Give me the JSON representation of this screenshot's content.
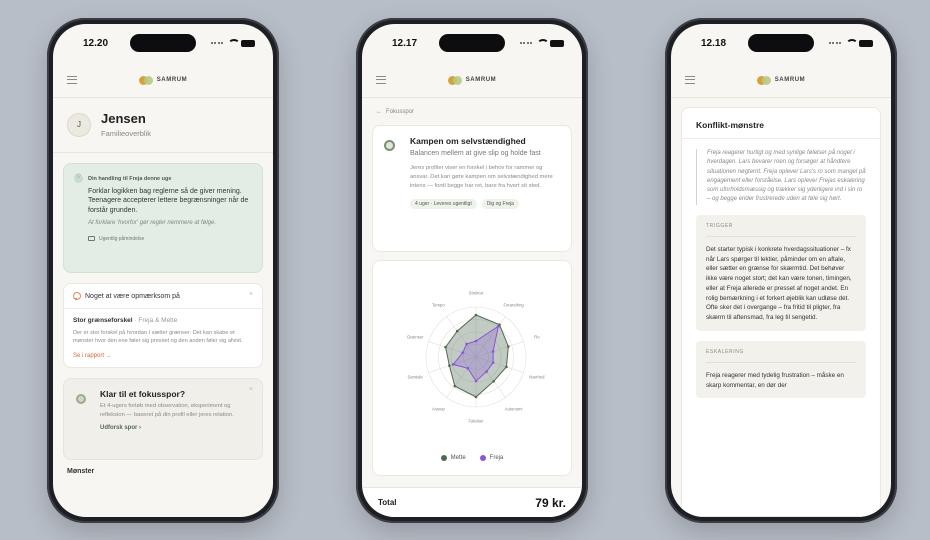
{
  "brand": "SAMRUM",
  "phone1": {
    "time": "12.20",
    "profile": {
      "initial": "J",
      "name": "Jensen",
      "subtitle": "Familieoverblik"
    },
    "action_card": {
      "header": "Din handling til Freja denne uge",
      "body": "Forklar logikken bag reglerne så de giver mening. Teenagere accepterer lettere begrænsninger når de forstår grunden.",
      "note": "At forklare 'hvorfor' gør regler nemmere at følge.",
      "link": "Ugentlig påmindelse"
    },
    "notice_card": {
      "header": "Noget at være opmærksom på",
      "close": "×",
      "title": "Stor grænseforskel",
      "who": "· Freja & Mette",
      "text": "Der er stor forskel på hvordan I sætter grænser. Det kan skabe et mønster hvor den ene føler sig presset og den anden føler sig afvist.",
      "link": "Se i rapport →"
    },
    "focus_card": {
      "title": "Klar til et fokusspor?",
      "close": "×",
      "text": "Et 4-ugers forløb med observation, eksperiment og refleksion — baseret på din profil eller jeres relation.",
      "link": "Udforsk spor ›"
    },
    "cut_text": "Mønster"
  },
  "phone2": {
    "time": "12.17",
    "back": "Fokusspor",
    "track": {
      "title": "Kampen om selvstændighed",
      "subtitle": "Balancen mellem at give slip og holde fast",
      "text": "Jeres profiler viser en forskel i behov for rammer og ansvar. Det kan gøre kampen om selvstændighed mere intens — fordi begge har ret, bare fra hvert sit sted.",
      "chips": [
        "4 uger · Leveres ugentligt",
        "Dig og Freja"
      ]
    },
    "chart_data": {
      "type": "radar",
      "axes": [
        "Struktur",
        "Forandring",
        "Ro",
        "Nærhed",
        "Autonomi",
        "Følelser",
        "Ansvar",
        "Samtale",
        "Grænser",
        "Tempo"
      ],
      "max": 5,
      "series": [
        {
          "name": "Mette",
          "color": "#4e6b52",
          "values": [
            4.2,
            4.0,
            3.4,
            3.2,
            3.0,
            4.0,
            3.6,
            2.8,
            3.2,
            3.2
          ]
        },
        {
          "name": "Freja",
          "color": "#8a55d8",
          "values": [
            1.6,
            3.8,
            1.8,
            1.8,
            1.8,
            2.4,
            1.4,
            2.4,
            1.4,
            1.6
          ]
        }
      ]
    },
    "total": {
      "label": "Total",
      "value": "79 kr."
    }
  },
  "phone3": {
    "time": "12.18",
    "title": "Konflikt-mønstre",
    "intro": "Freja reagerer hurtigt og med synlige følelser på noget i hverdagen. Lars bevarer roen og forsøger at håndtere situationen nøgternt. Freja oplever Lars's ro som mangel på engagement eller forståelse. Lars oplever Frejas eskalering som uforholdsmæssig og trækker sig yderligere ind i sin ro – og begge ender frustrerede uden at føle sig hørt.",
    "sections": [
      {
        "label": "TRIGGER",
        "text": "Det starter typisk i konkrete hverdagssituationer – fx når Lars spørger til lektier, påminder om en aftale, eller sætter en grænse for skærmtid. Det behøver ikke være noget stort; det kan være tonen, timingen, eller at Freja allerede er presset af noget andet. En rolig bemærkning i et forkert øjeblik kan udløse det. Ofte sker det i overgange – fra fritid til pligter, fra skærm til aftensmad, fra leg til sengetid."
      },
      {
        "label": "ESKALERING",
        "text": "Freja reagerer med tydelig frustration – måske en skarp kommentar, en dør der"
      }
    ]
  }
}
